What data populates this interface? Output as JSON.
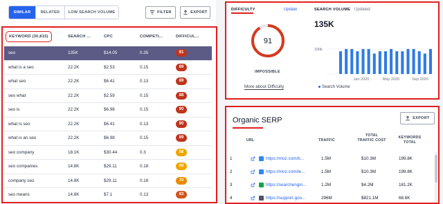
{
  "tabs": [
    "SIMILAR",
    "RELATED",
    "LOW SEARCH VOLUME"
  ],
  "toolbar": {
    "filter_label": "FILTER",
    "export_label": "EXPORT"
  },
  "table": {
    "headers": [
      "KEYWORD (30,815)",
      "SEARCH ...",
      "CPC",
      "COMPETI...",
      "DIFFICUL..."
    ],
    "rows": [
      {
        "kw": "seo",
        "sv": "135K",
        "cpc": "$14.05",
        "comp": "0.35",
        "diff": "91",
        "color": "#c0341d"
      },
      {
        "kw": "what is a seo",
        "sv": "22.2K",
        "cpc": "$2.53",
        "comp": "0.15",
        "diff": "89",
        "color": "#c0341d"
      },
      {
        "kw": "what seo",
        "sv": "22.2K",
        "cpc": "$6.41",
        "comp": "0.13",
        "diff": "89",
        "color": "#c0341d"
      },
      {
        "kw": "seo what",
        "sv": "22.2K",
        "cpc": "$2.59",
        "comp": "0.15",
        "diff": "88",
        "color": "#c0341d"
      },
      {
        "kw": "seo is",
        "sv": "22.2K",
        "cpc": "$6.98",
        "comp": "0.15",
        "diff": "90",
        "color": "#c0341d"
      },
      {
        "kw": "what is seo",
        "sv": "22.2K",
        "cpc": "$6.41",
        "comp": "0.13",
        "diff": "90",
        "color": "#c0341d"
      },
      {
        "kw": "what is an seo",
        "sv": "22.2K",
        "cpc": "$6.98",
        "comp": "0.15",
        "diff": "89",
        "color": "#c0341d"
      },
      {
        "kw": "seo company",
        "sv": "18.1K",
        "cpc": "$30.44",
        "comp": "0.3",
        "diff": "58",
        "color": "#f0a500"
      },
      {
        "kw": "seo companies",
        "sv": "14.8K",
        "cpc": "$29.11",
        "comp": "0.18",
        "diff": "60",
        "color": "#f0a500"
      },
      {
        "kw": "company seo",
        "sv": "14.8K",
        "cpc": "$29.11",
        "comp": "0.18",
        "diff": "70",
        "color": "#e88a00"
      },
      {
        "kw": "seo means",
        "sv": "14.8K",
        "cpc": "$7.1",
        "comp": "0.13",
        "diff": "83",
        "color": "#d2521b"
      }
    ]
  },
  "difficulty": {
    "label": "DIFFICULTY",
    "update_label": "Update",
    "score": "91",
    "score_value": 91,
    "rating": "IMPOSSIBLE",
    "more_link": "More about Difficulty",
    "color": "#d33a1e"
  },
  "search_volume": {
    "label": "SEARCH VOLUME",
    "updated_label": "Updated",
    "value": "135K",
    "legend": "Search Volume",
    "y_tick": "100k",
    "x_ticks": [
      "Jan 2020",
      "May 2020",
      "Sep 2020"
    ],
    "bar_color": "#2e7be6"
  },
  "chart_data": {
    "type": "bar",
    "title": "",
    "xlabel": "",
    "ylabel": "",
    "series": [
      {
        "name": "Search Volume",
        "values": [
          100,
          110,
          110,
          100,
          110,
          110,
          90,
          100,
          100,
          110,
          100,
          100,
          110,
          110,
          100,
          90,
          110
        ]
      }
    ],
    "ylim": [
      0,
      140
    ]
  },
  "serp": {
    "title": "Organic SERP",
    "export_label": "EXPORT",
    "headers": [
      "URL",
      "TRAFFIC",
      "TOTAL TRAFFIC COST",
      "KEYWORDS TOTAL"
    ],
    "rows": [
      {
        "pos": "1",
        "url": "https://moz.com/b...",
        "traffic": "1.5M",
        "cost": "$10.3M",
        "kws": "199.8K",
        "fav": "#2d89ef"
      },
      {
        "pos": "2",
        "url": "https://moz.com/le...",
        "traffic": "1.5M",
        "cost": "$10.3M",
        "kws": "199.8K",
        "fav": "#2d89ef"
      },
      {
        "pos": "3",
        "url": "https://searchengin...",
        "traffic": "1.2M",
        "cost": "$4.2M",
        "kws": "181.2K",
        "fav": "#16a34a"
      },
      {
        "pos": "4",
        "url": "https://support.goo...",
        "traffic": "296M",
        "cost": "$821.1M",
        "kws": "68.6K",
        "fav": "#4b5563"
      }
    ]
  }
}
